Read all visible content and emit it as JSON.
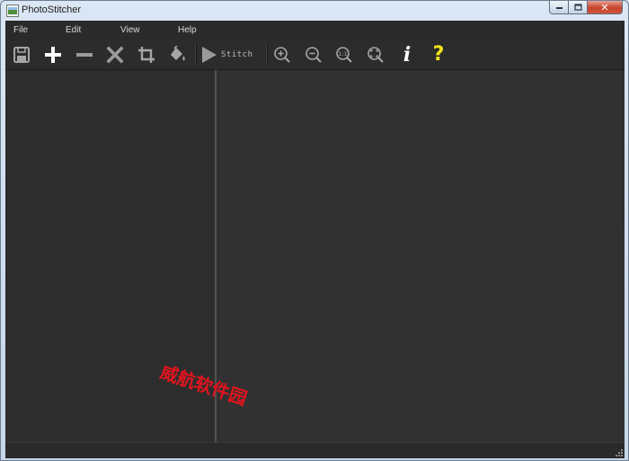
{
  "window": {
    "title": "PhotoStitcher",
    "icon": "photostitcher-app-icon",
    "caption_buttons": [
      "minimize-icon",
      "maximize-icon",
      "close-icon"
    ]
  },
  "menubar": {
    "items": [
      {
        "label": "File"
      },
      {
        "label": "Edit"
      },
      {
        "label": "View"
      },
      {
        "label": "Help"
      }
    ]
  },
  "toolbar": {
    "buttons": [
      {
        "icon": "save-icon"
      },
      {
        "icon": "add-icon"
      },
      {
        "icon": "remove-icon"
      },
      {
        "icon": "delete-icon"
      },
      {
        "icon": "crop-icon"
      },
      {
        "icon": "fill-bucket-icon"
      },
      {
        "icon": "play-icon",
        "label": "Stitch"
      },
      {
        "icon": "zoom-in-icon"
      },
      {
        "icon": "zoom-out-icon"
      },
      {
        "icon": "actual-size-icon",
        "label": "1:1"
      },
      {
        "icon": "fit-to-window-icon"
      },
      {
        "icon": "info-icon",
        "label": "i"
      },
      {
        "icon": "help-icon",
        "label": "?"
      }
    ]
  },
  "watermark": {
    "text": "威航软件园",
    "color": "#e0141e"
  },
  "colors": {
    "panel_bg": "#2d2d2d",
    "canvas_bg": "#313131",
    "help_accent": "#f4e21a"
  }
}
